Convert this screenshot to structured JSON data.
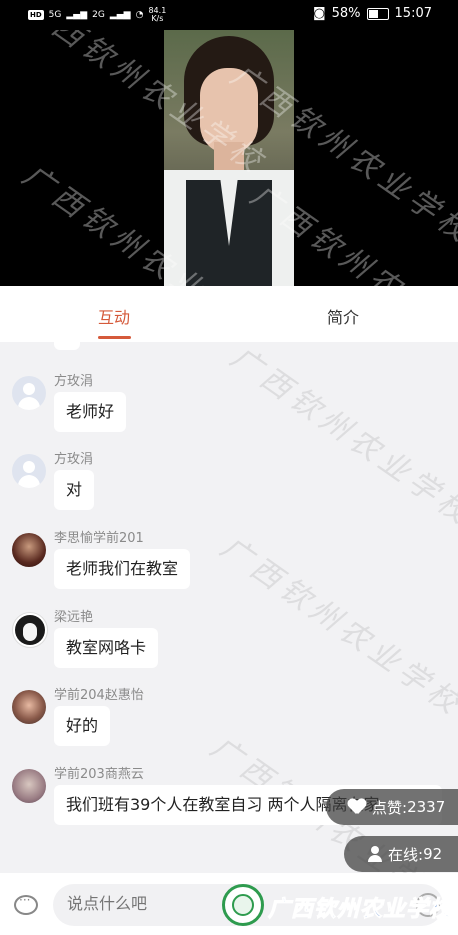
{
  "status_bar": {
    "signal_labels": [
      "HD",
      "5G",
      "2G"
    ],
    "speed": "84.1",
    "speed_unit": "K/s",
    "battery_percent": "58%",
    "battery_level": 0.58,
    "time": "15:07"
  },
  "video": {
    "watermark": "广西钦州农业学校"
  },
  "tabs": {
    "interaction": "互动",
    "intro": "简介"
  },
  "messages": [
    {
      "user": "方玫涓",
      "text": "老师好",
      "avatar": "default-avatar"
    },
    {
      "user": "方玫涓",
      "text": "对",
      "avatar": "default-avatar"
    },
    {
      "user": "李思愉学前201",
      "text": "老师我们在教室",
      "avatar": "photo-avatar"
    },
    {
      "user": "梁远艳",
      "text": "教室网咯卡",
      "avatar": "cartoon-avatar"
    },
    {
      "user": "学前204赵惠怡",
      "text": "好的",
      "avatar": "photo-avatar"
    },
    {
      "user": "学前203商燕云",
      "text": "我们班有39个人在教室自习   两个人隔离在家",
      "avatar": "photo-avatar"
    }
  ],
  "likes": {
    "label": "点赞:",
    "count": "2337"
  },
  "online": {
    "label": "在线:",
    "count": "92"
  },
  "input": {
    "placeholder": "说点什么吧"
  },
  "brand": {
    "school_name": "广西钦州农业学校",
    "color": "#1e5bbf",
    "logo_color": "#2e9b4e"
  },
  "colors": {
    "accent": "#d55a3b"
  }
}
